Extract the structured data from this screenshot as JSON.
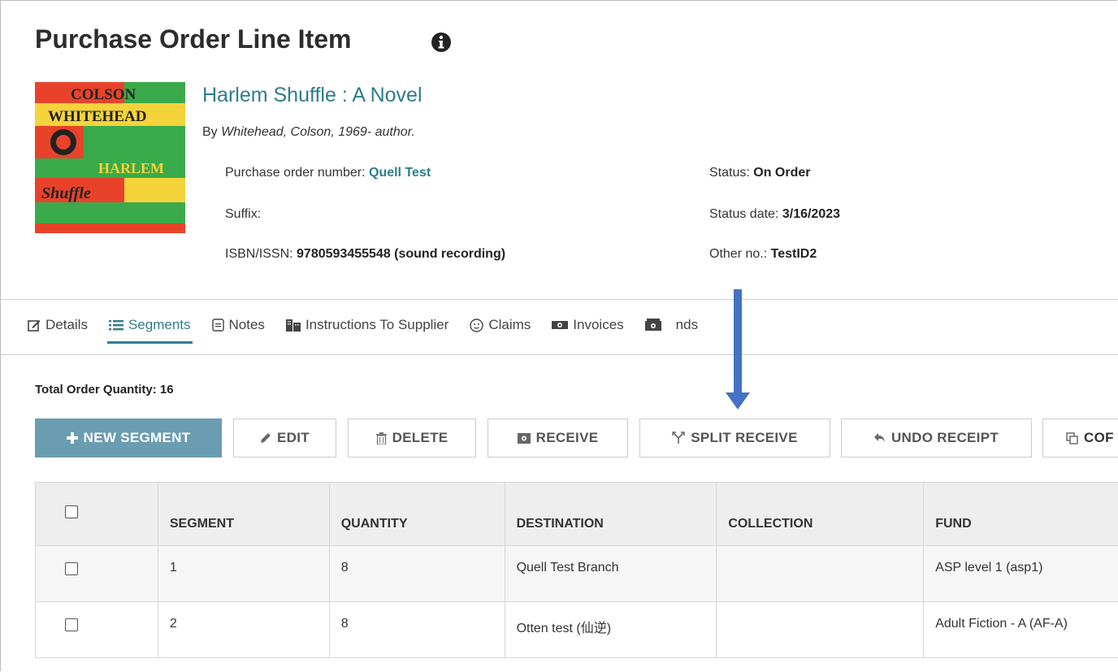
{
  "header": {
    "title": "Purchase Order Line Item",
    "info_icon": "info-circle-icon"
  },
  "book": {
    "title": "Harlem Shuffle : A Novel",
    "by_prefix": "By",
    "author": "Whitehead, Colson, 1969- author.",
    "cover": {
      "line1": "COLSON",
      "line2": "WHITEHEAD",
      "line3": "HARLEM",
      "line4": "Shuffle"
    }
  },
  "details": {
    "po_label": "Purchase order number:",
    "po_value": "Quell Test",
    "suffix_label": "Suffix:",
    "isbn_label": "ISBN/ISSN:",
    "isbn_value": "9780593455548 (sound recording)",
    "status_label": "Status:",
    "status_value": "On Order",
    "status_date_label": "Status date:",
    "status_date_value": "3/16/2023",
    "other_label": "Other no.:",
    "other_value": "TestID2"
  },
  "tabs": [
    {
      "label": "Details",
      "icon": "edit-icon"
    },
    {
      "label": "Segments",
      "icon": "list-icon"
    },
    {
      "label": "Notes",
      "icon": "note-icon"
    },
    {
      "label": "Instructions To Supplier",
      "icon": "building-icon"
    },
    {
      "label": "Claims",
      "icon": "face-icon"
    },
    {
      "label": "Invoices",
      "icon": "money-icon"
    },
    {
      "label": "nds",
      "icon": "fund-icon"
    }
  ],
  "total_order_quantity": "Total Order Quantity: 16",
  "toolbar": {
    "new_segment": "NEW SEGMENT",
    "edit": "EDIT",
    "delete": "DELETE",
    "receive": "RECEIVE",
    "split_receive": "SPLIT RECEIVE",
    "undo_receipt": "UNDO RECEIPT",
    "copy": "COF"
  },
  "table": {
    "headers": [
      "SEGMENT",
      "QUANTITY",
      "DESTINATION",
      "COLLECTION",
      "FUND"
    ],
    "rows": [
      {
        "segment": "1",
        "quantity": "8",
        "destination": "Quell Test Branch",
        "collection": "",
        "fund": "ASP level 1 (asp1)"
      },
      {
        "segment": "2",
        "quantity": "8",
        "destination": "Otten test (仙逆)",
        "collection": "",
        "fund": "Adult Fiction - A (AF-A)"
      }
    ]
  },
  "colors": {
    "accent": "#2f7c8e",
    "primary_button": "#6b9db0",
    "annotation_arrow": "#4472c4"
  }
}
